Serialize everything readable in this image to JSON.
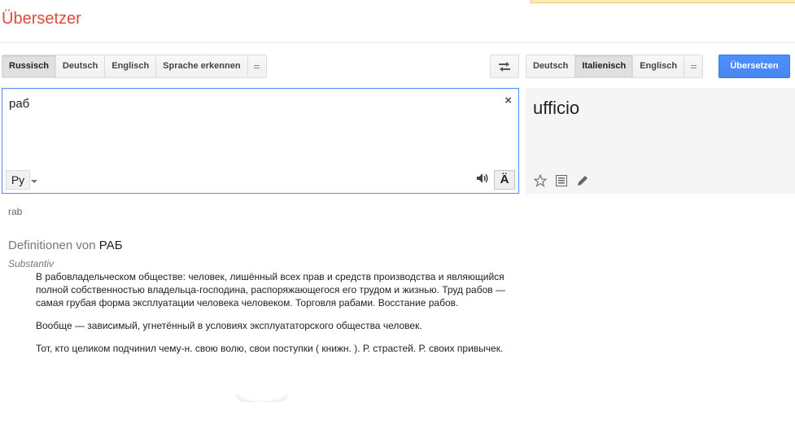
{
  "app": {
    "title": "Übersetzer"
  },
  "source_langs": {
    "items": [
      "Russisch",
      "Deutsch",
      "Englisch",
      "Sprache erkennen"
    ],
    "selected": "Russisch"
  },
  "target_langs": {
    "items": [
      "Deutsch",
      "Italienisch",
      "Englisch"
    ],
    "selected": "Italienisch"
  },
  "translate_button": {
    "label": "Übersetzen"
  },
  "source": {
    "text": "раб",
    "input_method": "Ру",
    "keyboard_label": "Ä",
    "clear_glyph": "×"
  },
  "result": {
    "text": "ufficio"
  },
  "transliteration": "rab",
  "definitions": {
    "heading_prefix": "Definitionen von",
    "word": "РАБ",
    "part_of_speech": "Substantiv",
    "entries": [
      "В рабовладельческом обществе: человек, лишённый всех прав и средств производства и являющийся полной собственностью владельца-господина, распоряжающегося его трудом и жизнью. Труд рабов — самая грубая форма эксплуатации человека человеком. Торговля рабами. Восстание рабов.",
      "Вообще — зависимый, угнетённый в условиях эксплуататорского общества человек.",
      "Тот, кто целиком подчинил чему-н. свою волю, свои поступки ( книжн. ). Р. страстей. Р. своих привычек."
    ]
  },
  "colors": {
    "title_red": "#dd4b39",
    "primary_blue": "#4d90fe",
    "result_bg": "#f5f5f5"
  },
  "icons": {
    "swap": "swap-arrows-icon",
    "speaker": "speaker-icon",
    "star": "star-icon",
    "list": "list-icon",
    "edit": "pencil-icon"
  }
}
